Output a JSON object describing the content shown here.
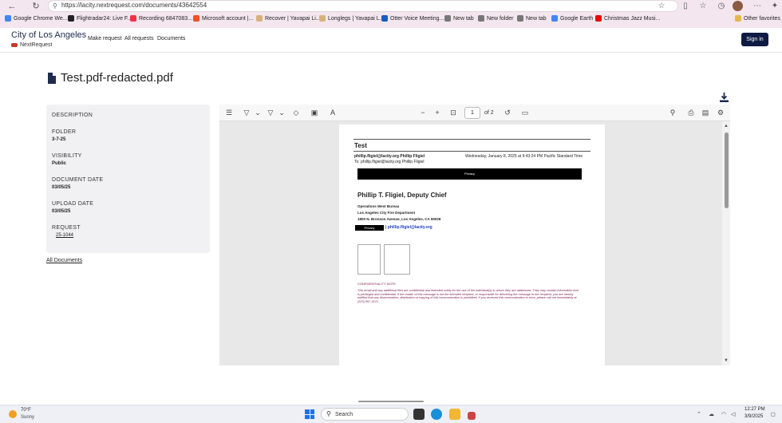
{
  "browser": {
    "url": "https://lacity.nextrequest.com/documents/43642554",
    "bookmarks": [
      {
        "label": "Google Chrome We...",
        "color": "#4285f4"
      },
      {
        "label": "Flightradar24: Live F...",
        "color": "#222"
      },
      {
        "label": "Recording 6847083...",
        "color": "#e34"
      },
      {
        "label": "Microsoft account |...",
        "color": "#f25022"
      },
      {
        "label": "Recover | Yavapai Li...",
        "color": "#d7b27a"
      },
      {
        "label": "Longlegs | Yavapai L...",
        "color": "#d7b27a"
      },
      {
        "label": "Otter Voice Meeting...",
        "color": "#1b5cb8"
      },
      {
        "label": "New tab",
        "color": "#555"
      },
      {
        "label": "New folder",
        "color": "#555"
      },
      {
        "label": "New tab",
        "color": "#555"
      },
      {
        "label": "Google Earth",
        "color": "#4285f4"
      },
      {
        "label": "Christmas Jazz Musi...",
        "color": "#e00"
      }
    ],
    "other_favorites": "Other favorites"
  },
  "header": {
    "brand_title": "City of Los Angeles",
    "brand_sub": "NextRequest",
    "nav": [
      "Make request",
      "All requests",
      "Documents"
    ],
    "signin": "Sign in"
  },
  "document": {
    "title": "Test.pdf-redacted.pdf"
  },
  "sidebar": {
    "description_label": "DESCRIPTION",
    "folder_label": "FOLDER",
    "folder_value": "3-7-25",
    "visibility_label": "VISIBILITY",
    "visibility_value": "Public",
    "document_date_label": "DOCUMENT DATE",
    "document_date_value": "03/05/25",
    "upload_date_label": "UPLOAD DATE",
    "upload_date_value": "03/05/25",
    "request_label": "REQUEST",
    "request_value": "25-1044",
    "all_documents": "All Documents"
  },
  "viewer": {
    "page_current": "1",
    "page_of": "of 2"
  },
  "pdf": {
    "heading": "Test",
    "from": "phillip.fligiel@lacity.org Phillip Fligiel",
    "date": "Wednesday, January 8, 2025 at 9:43:24 PM Pacific Standard Time",
    "to": "To: phillip.fligiel@lacity.org Phillip Fligiel",
    "privacy_bar": "Privacy",
    "name": "Phillip T. Fligiel, Deputy Chief",
    "line1": "Operations West Bureau",
    "line2": "Los Angeles City Fire Department",
    "line3": "1800 N. Bronson Avenue, Los Angeles, CA 90028",
    "privacy_small": "Privacy",
    "email": "| phillip.fligiel@lacity.org",
    "confidentiality_label": "CONFIDENTIALITY NOTE:",
    "confidentiality_body": "This email and any additional files are confidential and intended solely for the use of the individual(s) to whom they are addressed. They may contain information that is privileged and confidential. If the reader of this message is not the intended recipient, or responsible for delivering the message to the recipient, you are hereby notified that any dissemination, distribution or copying of this communication is prohibited. If you received this communication in error, please call me immediately at (323) 957-4121."
  },
  "taskbar": {
    "temp": "70°F",
    "condition": "Sunny",
    "search": "Search",
    "time": "12:27 PM",
    "date": "3/9/2025"
  }
}
